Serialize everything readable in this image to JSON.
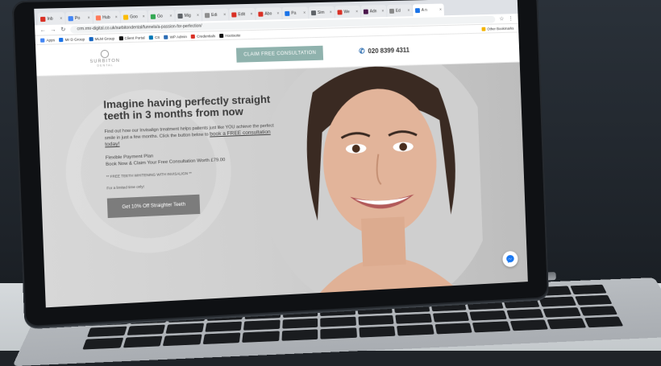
{
  "browser": {
    "tabs": [
      {
        "label": "Inb",
        "color": "#d93025"
      },
      {
        "label": "Po",
        "color": "#4285f4"
      },
      {
        "label": "Hub",
        "color": "#ff7a59"
      },
      {
        "label": "Goo",
        "color": "#fbbc04"
      },
      {
        "label": "Go",
        "color": "#34a853"
      },
      {
        "label": "Mig",
        "color": "#5f6368"
      },
      {
        "label": "Edi",
        "color": "#8e8e8e"
      },
      {
        "label": "Edit",
        "color": "#d93025"
      },
      {
        "label": "Abo",
        "color": "#d93025"
      },
      {
        "label": "Pa",
        "color": "#1a73e8"
      },
      {
        "label": "Sim",
        "color": "#5f6368"
      },
      {
        "label": "We",
        "color": "#d93025"
      },
      {
        "label": "Adn",
        "color": "#4a154b"
      },
      {
        "label": "Ed",
        "color": "#888888"
      },
      {
        "label": "A n",
        "color": "#1a73e8",
        "active": true
      }
    ],
    "url": "crm.rmr-digital.co.uk/surbitondental/funnels/a-passion-for-perfection/",
    "bookmarks": [
      "Apps",
      "Mr D Group",
      "MLM Group",
      "Client Portal",
      "CS",
      "WP Admin",
      "Credentials",
      "Hootsuite"
    ],
    "other_bookmarks": "Other Bookmarks"
  },
  "site": {
    "logo_name": "SURBITON",
    "logo_sub": "DENTAL",
    "cta_top": "CLAIM FREE CONSULTATION",
    "phone": "020 8399 4311"
  },
  "hero": {
    "headline": "Imagine having perfectly straight teeth in 3 months from now",
    "para_1": "Find out how our Invisalign treatment helps patients just like YOU achieve the perfect smile in just a few months. Click the button below to",
    "para_link": "book a FREE consultation today!",
    "plan_1": "Flexible Payment Plan",
    "plan_2": "Book Now & Claim Your Free Consultation Worth £79.00",
    "note": "** FREE TEETH WHITENING WITH INVISALIGN **",
    "note2": "For a limited time only!",
    "cta_main": "Get 10% Off Straighter Teeth"
  },
  "icons": {
    "phone": "phone-icon",
    "messenger": "messenger-icon"
  }
}
